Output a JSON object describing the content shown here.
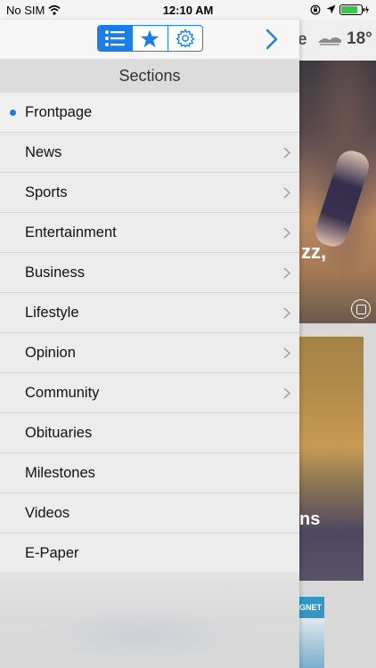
{
  "status_bar": {
    "carrier": "No SIM",
    "time": "12:10 AM"
  },
  "toolbar": {
    "tabs": [
      {
        "icon": "list-icon",
        "active": true
      },
      {
        "icon": "star-icon",
        "active": false
      },
      {
        "icon": "gear-icon",
        "active": false
      }
    ],
    "forward_icon": "chevron-right-icon"
  },
  "sections": {
    "title": "Sections",
    "items": [
      {
        "label": "Frontpage",
        "selected": true,
        "has_children": false
      },
      {
        "label": "News",
        "selected": false,
        "has_children": true
      },
      {
        "label": "Sports",
        "selected": false,
        "has_children": true
      },
      {
        "label": "Entertainment",
        "selected": false,
        "has_children": true
      },
      {
        "label": "Business",
        "selected": false,
        "has_children": true
      },
      {
        "label": "Lifestyle",
        "selected": false,
        "has_children": true
      },
      {
        "label": "Opinion",
        "selected": false,
        "has_children": true
      },
      {
        "label": "Community",
        "selected": false,
        "has_children": true
      },
      {
        "label": "Obituaries",
        "selected": false,
        "has_children": false
      },
      {
        "label": "Milestones",
        "selected": false,
        "has_children": false
      },
      {
        "label": "Videos",
        "selected": false,
        "has_children": false
      },
      {
        "label": "E-Paper",
        "selected": false,
        "has_children": false
      }
    ]
  },
  "background": {
    "header_letter": "e",
    "temperature": "18°",
    "story1_caption": "zz,",
    "story2_caption": "ns",
    "ad_label": "GNET"
  },
  "colors": {
    "accent": "#1a7ee6"
  }
}
